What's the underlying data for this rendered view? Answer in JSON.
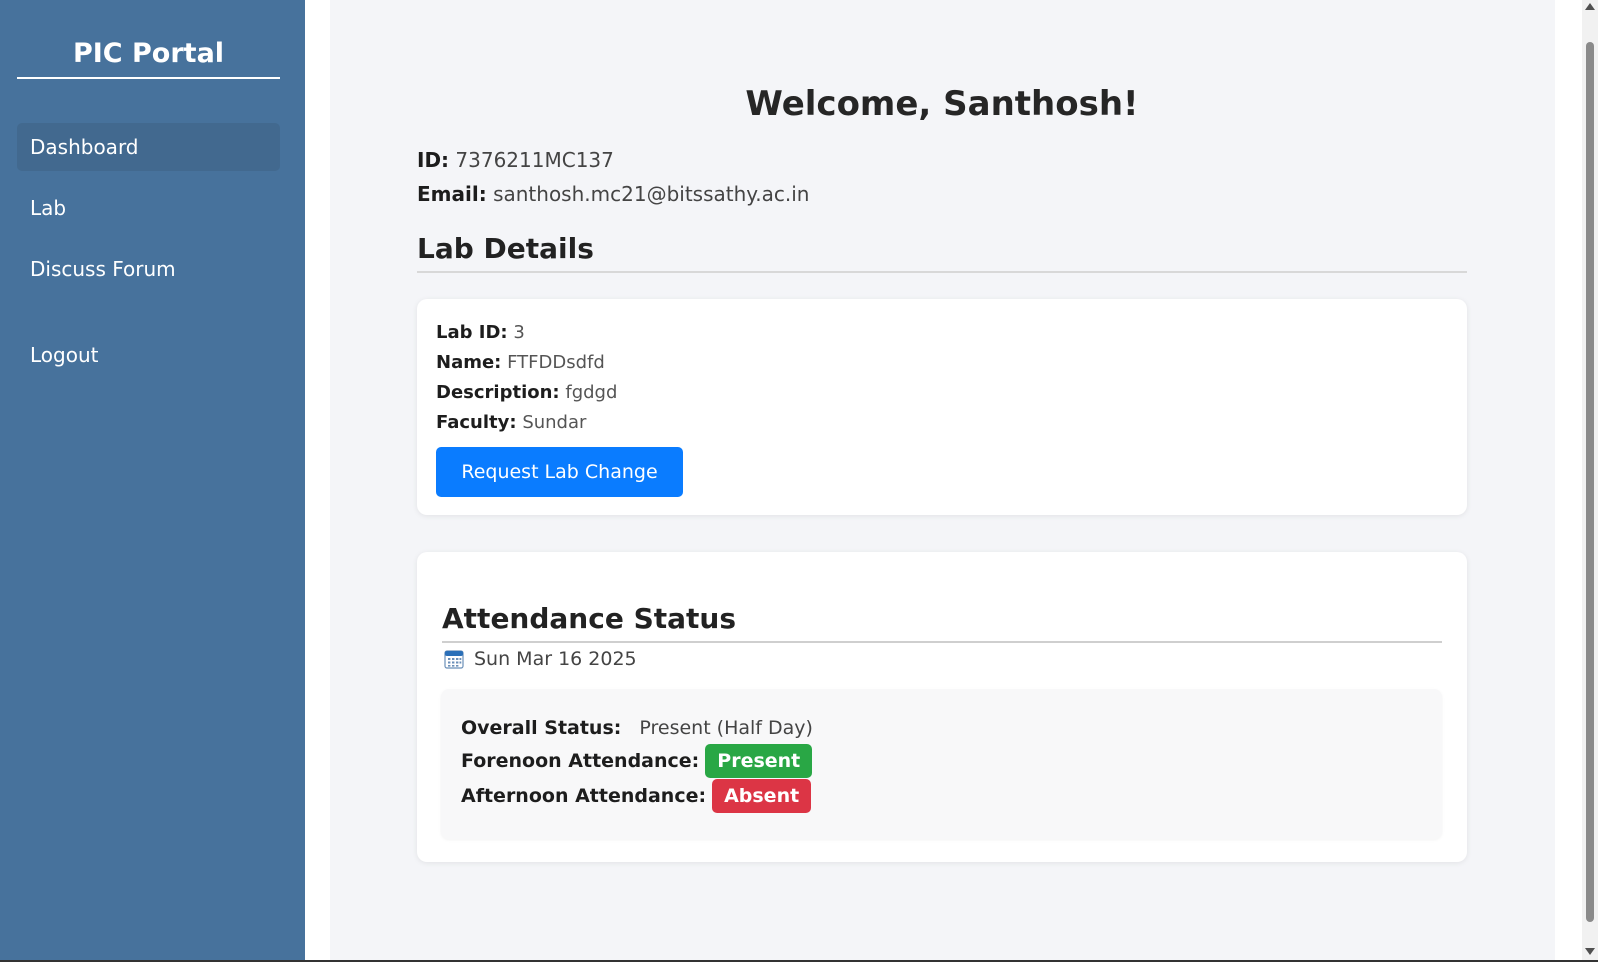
{
  "sidebar": {
    "brand": "PIC Portal",
    "items": [
      {
        "label": "Dashboard",
        "active": true
      },
      {
        "label": "Lab",
        "active": false
      },
      {
        "label": "Discuss Forum",
        "active": false
      }
    ],
    "logout": "Logout"
  },
  "main": {
    "welcome": "Welcome, Santhosh!",
    "id_label": "ID:",
    "id_value": "7376211MC137",
    "email_label": "Email:",
    "email_value": "santhosh.mc21@bitssathy.ac.in",
    "lab_section_title": "Lab Details",
    "lab": {
      "id_label": "Lab ID:",
      "id_value": "3",
      "name_label": "Name:",
      "name_value": "FTFDDsdfd",
      "desc_label": "Description:",
      "desc_value": "fgdgd",
      "faculty_label": "Faculty:",
      "faculty_value": "Sundar",
      "request_button": "Request Lab Change"
    },
    "attendance": {
      "title": "Attendance Status",
      "date_icon": "calendar-icon",
      "date": "Sun Mar 16 2025",
      "overall_label": "Overall Status:",
      "overall_value": "Present (Half Day)",
      "forenoon_label": "Forenoon Attendance:",
      "forenoon_value": "Present",
      "afternoon_label": "Afternoon Attendance:",
      "afternoon_value": "Absent"
    }
  },
  "colors": {
    "sidebar": "#47729c",
    "primary_button": "#0a7cff",
    "present": "#29a745",
    "absent": "#dc3545"
  }
}
